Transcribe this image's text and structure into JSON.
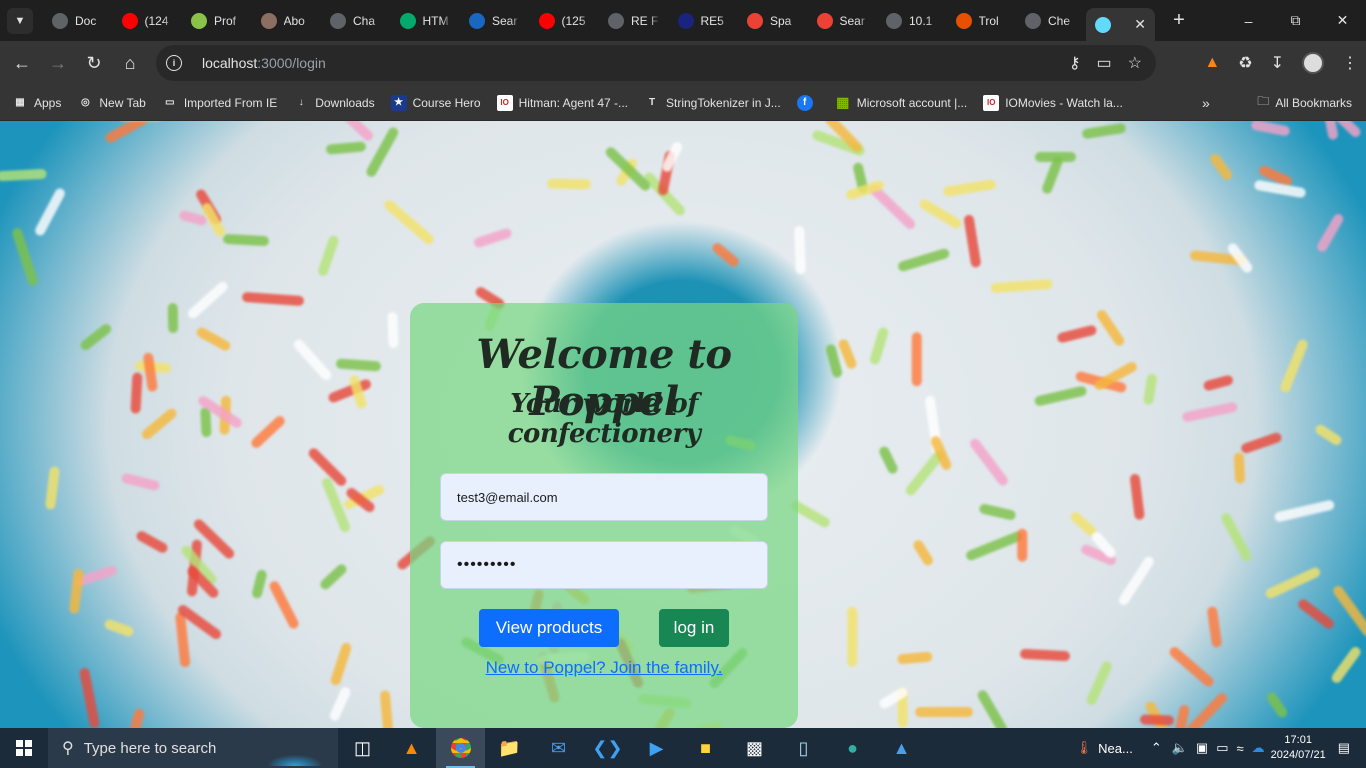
{
  "browser": {
    "tabs": [
      {
        "label": "Doc",
        "icon": "globe-icon",
        "color": "#5f6368"
      },
      {
        "label": "(124",
        "icon": "youtube-icon",
        "color": "#ff0000"
      },
      {
        "label": "Prof",
        "icon": "profile-app-icon",
        "color": "#8bc34a"
      },
      {
        "label": "Abo",
        "icon": "avatar-icon",
        "color": "#8d6e63"
      },
      {
        "label": "Cha",
        "icon": "chatgpt-icon",
        "color": "#5f6368"
      },
      {
        "label": "HTM",
        "icon": "w3-icon",
        "color": "#04aa6d"
      },
      {
        "label": "Sear",
        "icon": "vuetify-icon",
        "color": "#1867c0"
      },
      {
        "label": "(125",
        "icon": "youtube-icon",
        "color": "#ff0000"
      },
      {
        "label": "RE F",
        "icon": "globe-icon",
        "color": "#5f6368"
      },
      {
        "label": "RE5",
        "icon": "flag-icon",
        "color": "#1a237e"
      },
      {
        "label": "Spa",
        "icon": "gmail-icon",
        "color": "#ea4335"
      },
      {
        "label": "Sear",
        "icon": "gmail-icon",
        "color": "#ea4335"
      },
      {
        "label": "10.1",
        "icon": "globe-icon",
        "color": "#5f6368"
      },
      {
        "label": "Trol",
        "icon": "shield-icon",
        "color": "#e65100"
      },
      {
        "label": "Che",
        "icon": "globe-icon",
        "color": "#5f6368"
      },
      {
        "label": "",
        "icon": "react-icon",
        "color": "#61dafb"
      }
    ],
    "url_host": "localhost",
    "url_path": ":3000/login",
    "bookmarks": [
      {
        "label": "Apps",
        "icon": "apps-grid-icon",
        "color": "#e3e3e3"
      },
      {
        "label": "New Tab",
        "icon": "globe-icon",
        "color": "#e3e3e3"
      },
      {
        "label": "Imported From IE",
        "icon": "folder-icon",
        "color": "#e3e3e3"
      },
      {
        "label": "Downloads",
        "icon": "download-icon",
        "color": "#e3e3e3"
      },
      {
        "label": "Course Hero",
        "icon": "star-icon",
        "color": "#1a3a8f"
      },
      {
        "label": "Hitman: Agent 47 -...",
        "icon": "io-icon",
        "color": "#c62828"
      },
      {
        "label": "StringTokenizer in J...",
        "icon": "t-icon",
        "color": "#e3e3e3"
      },
      {
        "label": "",
        "icon": "facebook-icon",
        "color": "#1877f2"
      },
      {
        "label": "Microsoft account |...",
        "icon": "microsoft-icon",
        "color": "#f25022"
      },
      {
        "label": "IOMovies - Watch la...",
        "icon": "io-icon",
        "color": "#c62828"
      }
    ],
    "all_bookmarks": "All Bookmarks"
  },
  "login": {
    "title": "Welcome to Poppel",
    "subtitle": "Your world of confectionery",
    "email_value": "test3@email.com",
    "password_mask": "•••••••••",
    "view_products": "View products",
    "login_button": "log in",
    "join_link": "New to Poppel? Join the family."
  },
  "taskbar": {
    "search_placeholder": "Type here to search",
    "weather": "Nea...",
    "time": "17:01",
    "date": "2024/07/21"
  },
  "colors": {
    "card_bg": "#78d782",
    "btn_primary": "#0d6efd",
    "btn_success": "#198754",
    "link": "#0d6efd"
  }
}
